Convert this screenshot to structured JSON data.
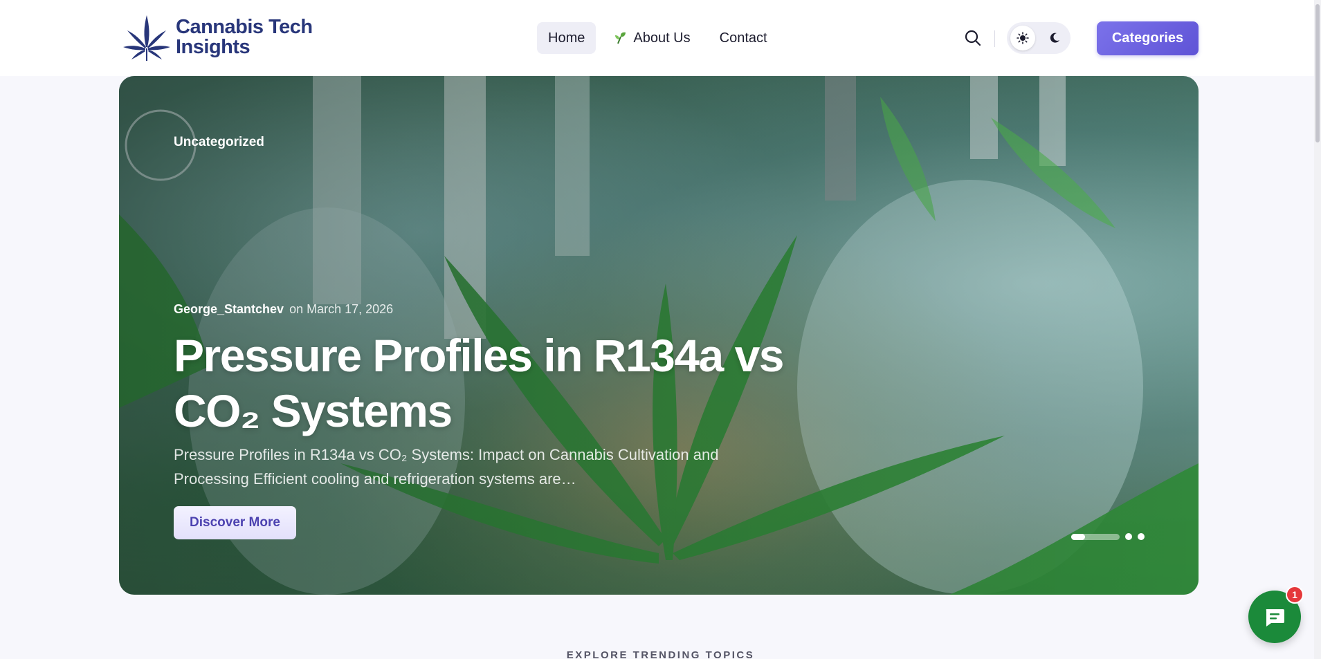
{
  "brand": {
    "name_line1": "Cannabis Tech",
    "name_line2": "Insights",
    "logo_icon": "cannabis-leaf-icon"
  },
  "nav": {
    "items": [
      {
        "label": "Home",
        "active": true
      },
      {
        "label": "About Us",
        "icon": "sprout-icon"
      },
      {
        "label": "Contact"
      }
    ]
  },
  "header": {
    "search_icon": "search-icon",
    "theme_light_icon": "sun-icon",
    "theme_dark_icon": "moon-icon",
    "theme_selected": "light",
    "categories_label": "Categories"
  },
  "hero": {
    "category": "Uncategorized",
    "author": "George_Stantchev",
    "date": "on March 17, 2026",
    "title": "Pressure Profiles in R134a vs CO₂ Systems",
    "excerpt": "Pressure Profiles in R134a vs CO₂ Systems: Impact on Cannabis Cultivation and Processing Efficient cooling and refrigeration systems are…",
    "cta_label": "Discover More",
    "slider": {
      "total_slides": 3,
      "active_slide": 1,
      "progress": 0.28
    }
  },
  "section": {
    "label": "EXPLORE TRENDING TOPICS"
  },
  "chat": {
    "icon": "chat-bubble-icon",
    "badge_count": "1"
  },
  "colors": {
    "brand_navy": "#28367a",
    "accent_purple": "#6a5fe0",
    "chat_green": "#1b8a3a",
    "badge_red": "#e5383b"
  }
}
